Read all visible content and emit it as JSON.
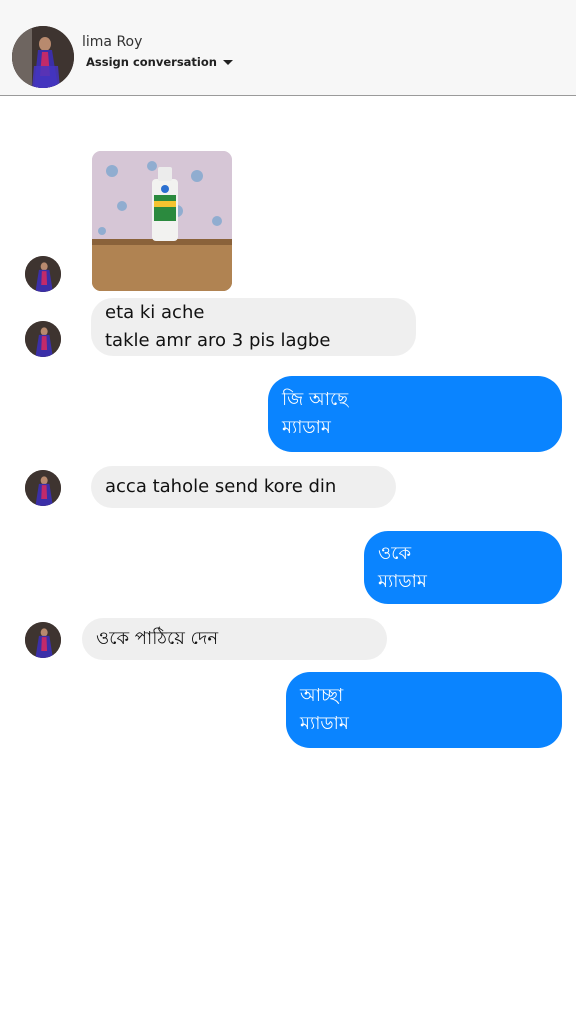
{
  "header": {
    "contact_name": "lima Roy",
    "assign_label": "Assign conversation"
  },
  "messages": [
    {
      "from": "contact",
      "type": "image",
      "alt": ""
    },
    {
      "from": "contact",
      "type": "text",
      "lines": [
        "eta ki ache",
        "takle amr aro 3 pis lagbe"
      ]
    },
    {
      "from": "me",
      "type": "text",
      "lines": [
        "জি আছে",
        "ম্যাডাম"
      ]
    },
    {
      "from": "contact",
      "type": "text",
      "lines": [
        "acca tahole send kore din"
      ]
    },
    {
      "from": "me",
      "type": "text",
      "lines": [
        "ওকে",
        "ম্যাডাম"
      ]
    },
    {
      "from": "contact",
      "type": "text",
      "lines": [
        "ওকে পাঠিয়ে দেন"
      ]
    },
    {
      "from": "me",
      "type": "text",
      "lines": [
        "আচ্ছা",
        "ম্যাডাম"
      ]
    }
  ],
  "colors": {
    "outgoing_bubble": "#0a84ff",
    "incoming_bubble": "#efefef",
    "header_bg": "#f7f7f7"
  }
}
